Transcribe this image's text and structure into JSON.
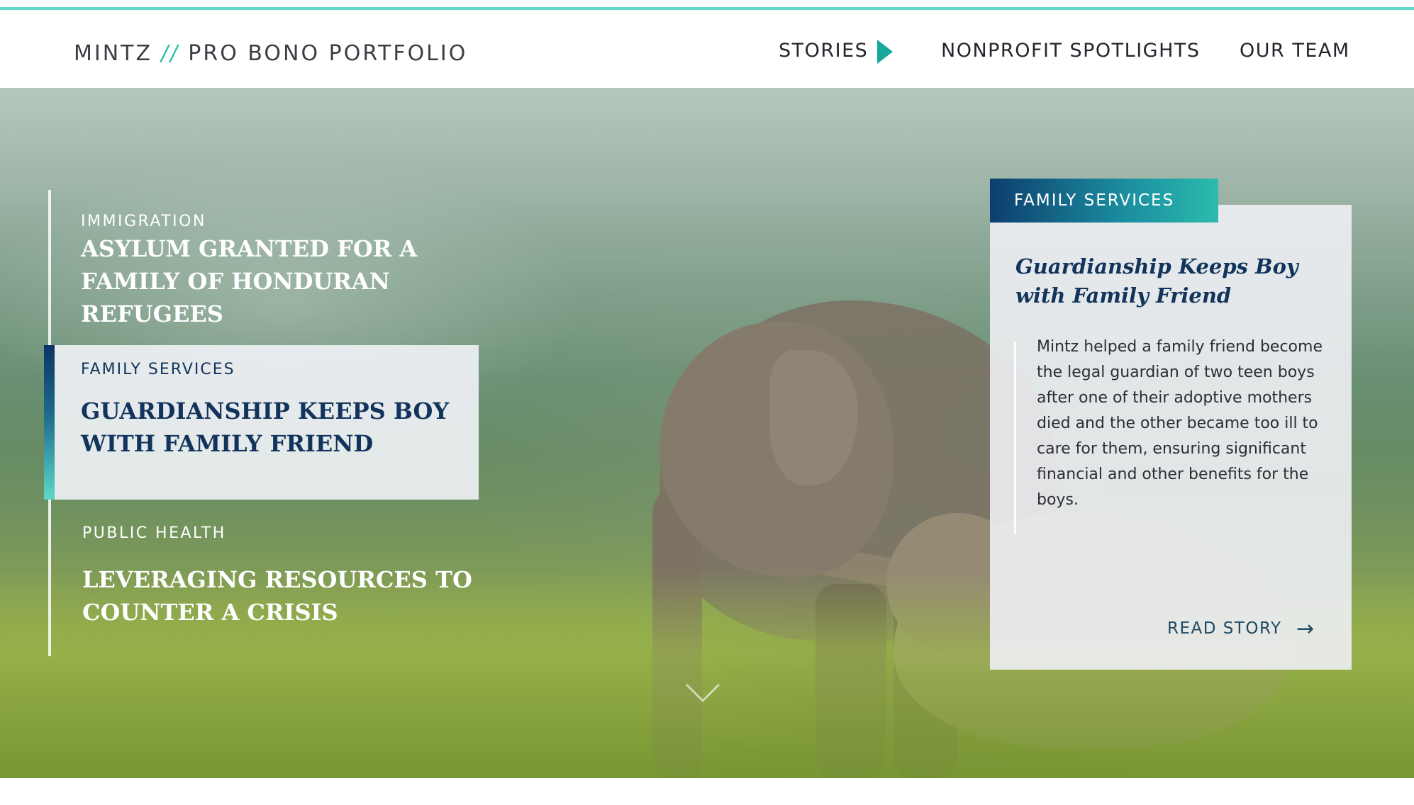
{
  "header": {
    "brand_name": "MINTZ",
    "brand_separator": "//",
    "brand_subtitle": "PRO BONO PORTFOLIO",
    "nav": [
      {
        "label": "STORIES"
      },
      {
        "label": "NONPROFIT SPOTLIGHTS"
      },
      {
        "label": "OUR TEAM"
      }
    ]
  },
  "stories": [
    {
      "category": "IMMIGRATION",
      "title": "ASYLUM GRANTED FOR A FAMILY OF HONDURAN REFUGEES"
    },
    {
      "category": "FAMILY SERVICES",
      "title": "GUARDIANSHIP KEEPS BOY WITH FAMILY FRIEND"
    },
    {
      "category": "PUBLIC HEALTH",
      "title": "LEVERAGING RESOURCES TO COUNTER A CRISIS"
    }
  ],
  "card": {
    "tag": "FAMILY SERVICES",
    "title": "Guardianship Keeps Boy with Family Friend",
    "body": "Mintz helped a family friend become the legal guardian of two teen boys after one of their adoptive mothers died and the other became too ill to care for them, ensuring significant financial and other benefits for the boys.",
    "cta": "READ STORY",
    "cta_arrow": "→"
  },
  "colors": {
    "accent_teal": "#17a89c",
    "navy": "#12335c",
    "light_accent": "#5fd8c8"
  },
  "icons": {
    "nav_active": "triangle-right-icon",
    "cta": "arrow-right-icon",
    "scroll": "chevron-down-icon"
  }
}
